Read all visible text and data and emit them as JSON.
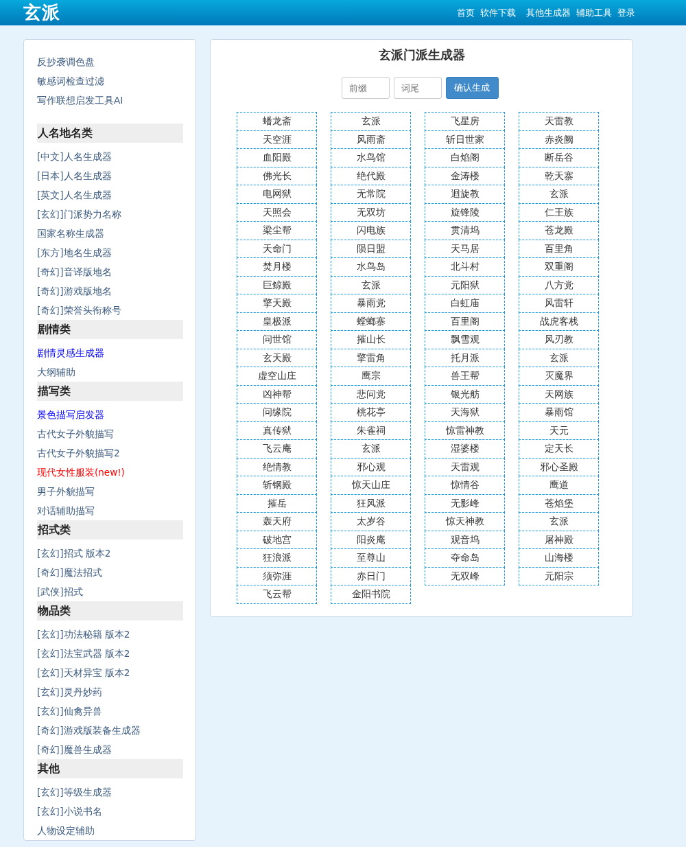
{
  "header": {
    "logo": "玄派",
    "nav": [
      "首页",
      "软件下载",
      "其他生成器",
      "辅助工具",
      "登录"
    ]
  },
  "sidebar": {
    "links": [
      {
        "label": "反抄袭调色盘",
        "kind": "default"
      },
      {
        "label": "敏感词检查过滤",
        "kind": "default"
      },
      {
        "label": "写作联想启发工具AI",
        "kind": "default"
      }
    ],
    "sections": [
      {
        "title": "人名地名类",
        "links": [
          {
            "label": "[中文]人名生成器",
            "kind": "default"
          },
          {
            "label": "[日本]人名生成器",
            "kind": "default"
          },
          {
            "label": "[英文]人名生成器",
            "kind": "default"
          },
          {
            "label": "[玄幻]门派势力名称",
            "kind": "default"
          },
          {
            "label": "国家名称生成器",
            "kind": "default"
          },
          {
            "label": "[东方]地名生成器",
            "kind": "default"
          },
          {
            "label": "[奇幻]音译版地名",
            "kind": "default"
          },
          {
            "label": "[奇幻]游戏版地名",
            "kind": "default"
          },
          {
            "label": "[奇幻]荣誉头衔称号",
            "kind": "default"
          }
        ]
      },
      {
        "title": "剧情类",
        "links": [
          {
            "label": "剧情灵感生成器",
            "kind": "featured"
          },
          {
            "label": "大纲辅助",
            "kind": "default"
          }
        ]
      },
      {
        "title": "描写类",
        "links": [
          {
            "label": "景色描写启发器",
            "kind": "featured"
          },
          {
            "label": "古代女子外貌描写",
            "kind": "default"
          },
          {
            "label": "古代女子外貌描写2",
            "kind": "default"
          },
          {
            "label": "现代女性服装(new!)",
            "kind": "new"
          },
          {
            "label": "男子外貌描写",
            "kind": "default"
          },
          {
            "label": "对话辅助描写",
            "kind": "default"
          }
        ]
      },
      {
        "title": "招式类",
        "links": [
          {
            "label": "[玄幻]招式 版本2",
            "kind": "default"
          },
          {
            "label": "[奇幻]魔法招式",
            "kind": "default"
          },
          {
            "label": "[武侠]招式",
            "kind": "default"
          }
        ]
      },
      {
        "title": "物品类",
        "links": [
          {
            "label": "[玄幻]功法秘籍 版本2",
            "kind": "default"
          },
          {
            "label": "[玄幻]法宝武器 版本2",
            "kind": "default"
          },
          {
            "label": "[玄幻]天材异宝 版本2",
            "kind": "default"
          },
          {
            "label": "[玄幻]灵丹妙药",
            "kind": "default"
          },
          {
            "label": "[玄幻]仙禽异兽",
            "kind": "default"
          },
          {
            "label": "[奇幻]游戏版装备生成器",
            "kind": "default"
          },
          {
            "label": "[奇幻]魔兽生成器",
            "kind": "default"
          }
        ]
      },
      {
        "title": "其他",
        "links": [
          {
            "label": "[玄幻]等级生成器",
            "kind": "default"
          },
          {
            "label": "[玄幻]小说书名",
            "kind": "default"
          },
          {
            "label": "人物设定辅助",
            "kind": "default"
          }
        ]
      }
    ]
  },
  "generator": {
    "title": "玄派门派生成器",
    "prefix_field": {
      "placeholder": "前缀"
    },
    "suffix_field": {
      "placeholder": "词尾"
    },
    "button": "确认生成",
    "columns": [
      [
        "蟠龙斋",
        "天空涯",
        "血阳殿",
        "佛光长",
        "电网狱",
        "天照会",
        "梁尘帮",
        "天命门",
        "焚月楼",
        "巨鲸殿",
        "擎天殿",
        "皇极派",
        "问世馆",
        "玄天殿",
        "虚空山庄",
        "凶神帮",
        "问缘院",
        "真传狱",
        "飞云庵",
        "绝情教",
        "斩钢殿",
        "摧岳",
        "轰天府",
        "破地宫",
        "狂浪派",
        "须弥涯",
        "飞云帮"
      ],
      [
        "玄派",
        "风雨斋",
        "水鸟馆",
        "绝代殿",
        "无常院",
        "无双坊",
        "闪电族",
        "陨日盟",
        "水鸟岛",
        "玄派",
        "暴雨党",
        "螳螂寨",
        "摧山长",
        "擎雷角",
        "鹰宗",
        "悲问党",
        "桃花亭",
        "朱雀祠",
        "玄派",
        "邪心观",
        "惊天山庄",
        "狂风派",
        "太岁谷",
        "阳炎庵",
        "至尊山",
        "赤日门",
        "金阳书院"
      ],
      [
        "飞星房",
        "斩日世家",
        "白焰阁",
        "金涛楼",
        "迴旋教",
        "旋锋陵",
        "贯清坞",
        "天马居",
        "北斗村",
        "元阳狱",
        "白虹庙",
        "百里阁",
        "飘雪观",
        "托月派",
        "兽王帮",
        "银光舫",
        "天海狱",
        "惊雷神教",
        "湿婆楼",
        "天雷观",
        "惊情谷",
        "无影峰",
        "惊天神教",
        "观音坞",
        "夺命岛",
        "无双峰"
      ],
      [
        "天雷教",
        "赤炎阙",
        "断岳谷",
        "乾天寨",
        "玄派",
        "仁王族",
        "苍龙殿",
        "百里角",
        "双重阁",
        "八方党",
        "风雷轩",
        "战虎客栈",
        "风刃教",
        "玄派",
        "灭魔界",
        "天网族",
        "暴雨馆",
        "天元",
        "定天长",
        "邪心圣殿",
        "鹰道",
        "苍焰堡",
        "玄派",
        "屠神殿",
        "山海楼",
        "元阳宗"
      ]
    ]
  }
}
